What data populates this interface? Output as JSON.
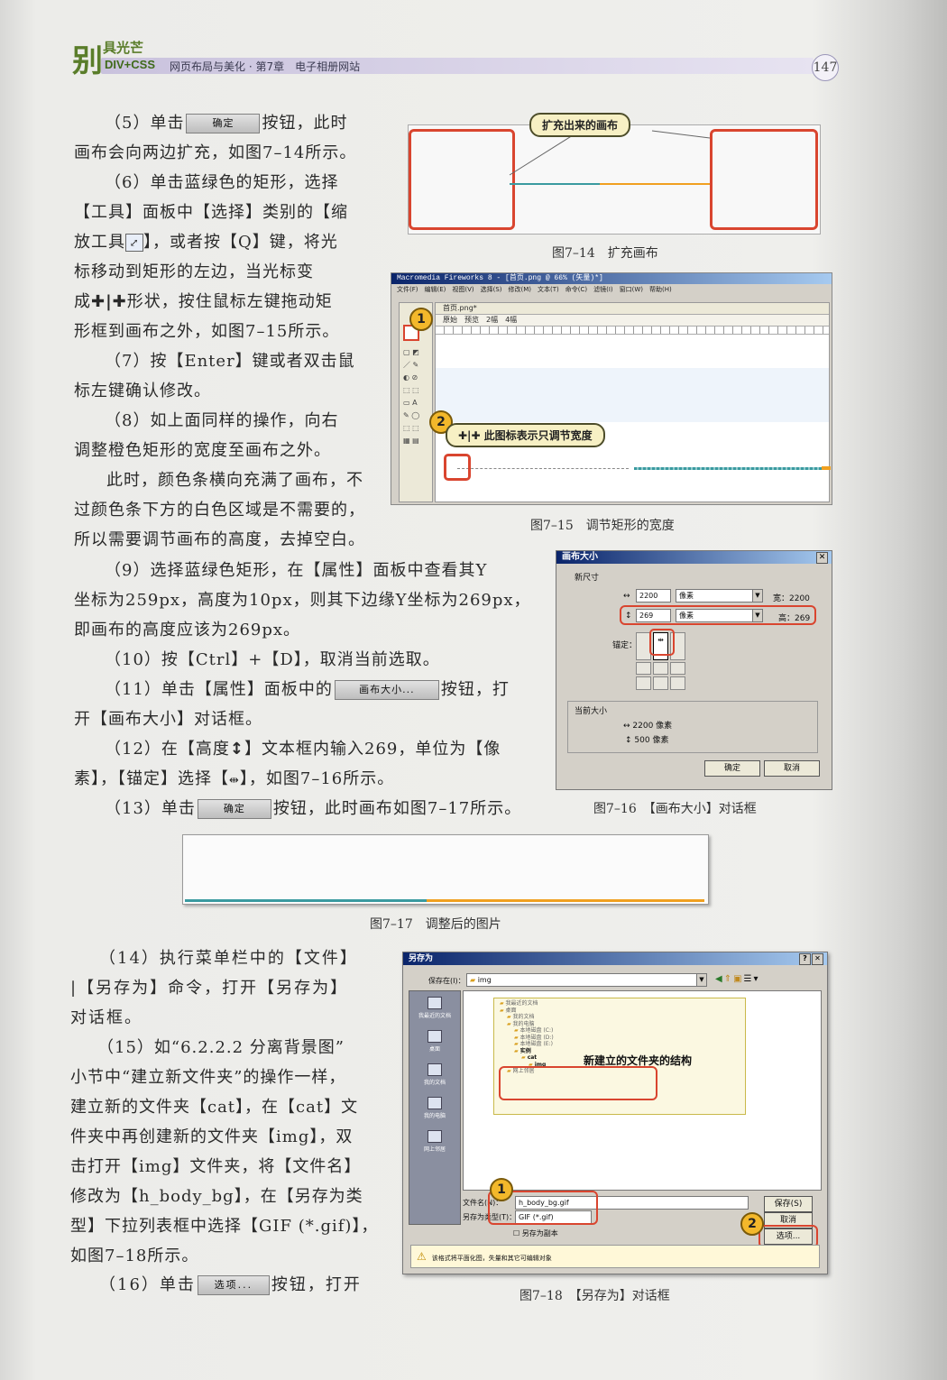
{
  "header": {
    "logo_char": "别",
    "logo_rest": "具光芒",
    "series": "DIV+CSS",
    "title": "网页布局与美化 · 第7章　电子相册网站",
    "page_number": "147"
  },
  "buttons": {
    "ok": "确定",
    "canvas_size": "画布大小...",
    "options": "选项..."
  },
  "body": {
    "s5a": "（5）单击",
    "s5b": "按钮，此时",
    "s5c": "画布会向两边扩充，如图7–14所示。",
    "s6a": "（6）单击蓝绿色的矩形，选择",
    "s6b": "【工具】面板中【选择】类别的【缩",
    "s6c": "放工具",
    "s6d": "】，或者按【Q】键，将光",
    "s6e": "标移动到矩形的左边，当光标变",
    "s6f": "成",
    "s6g": "形状，按住鼠标左键拖动矩",
    "s6h": "形框到画布之外，如图7–15所示。",
    "s7a": "（7）按【Enter】键或者双击鼠",
    "s7b": "标左键确认修改。",
    "s8a": "（8）如上面同样的操作，向右",
    "s8b": "调整橙色矩形的宽度至画布之外。",
    "n1": "此时，颜色条横向充满了画布，不",
    "n2": "过颜色条下方的白色区域是不需要的，",
    "n3": "所以需要调节画布的高度，去掉空白。",
    "s9a": "（9）选择蓝绿色矩形，在【属性】面板中查看其Y",
    "s9b": "坐标为259px，高度为10px，则其下边缘Y坐标为269px，",
    "s9c": "即画布的高度应该为269px。",
    "s10": "（10）按【Ctrl】+【D】，取消当前选取。",
    "s11a": "（11）单击【属性】面板中的",
    "s11b": "按钮，打",
    "s11c": "开【画布大小】对话框。",
    "s12a": "（12）在【高度",
    "s12b": "】文本框内输入269，单位为【像",
    "s12c": "素】，【锚定】选择【",
    "s12d": "】，如图7–16所示。",
    "s13a": "（13）单击",
    "s13b": "按钮，此时画布如图7–17所示。",
    "s14a": "（14）执行菜单栏中的【文件】",
    "s14b": "|【另存为】命令，打开【另存为】",
    "s14c": "对话框。",
    "s15a": "（15）如“6.2.2.2 分离背景图”",
    "s15b": "小节中“建立新文件夹”的操作一样，",
    "s15c": "建立新的文件夹【cat】，在【cat】文",
    "s15d": "件夹中再创建新的文件夹【img】，双",
    "s15e": "击打开【img】文件夹，将【文件名】",
    "s15f": "修改为【h_body_bg】，在【另存为类",
    "s15g": "型】下拉列表框中选择【GIF (*.gif)】，",
    "s15h": "如图7–18所示。",
    "s16a": "（16）单击",
    "s16b": "按钮，打开"
  },
  "fig14": {
    "callout": "扩充出来的画布",
    "caption": "图7–14　扩充画布"
  },
  "fig15": {
    "window_title": "Macromedia Fireworks 8 - [首页.png @ 66% (矢量)*]",
    "menu": "文件(F)　编辑(E)　视图(V)　选择(S)　修改(M)　文本(T)　命令(C)　滤镜(I)　窗口(W)　帮助(H)",
    "tab": "首页.png*",
    "view_tabs": "原始　预览　2幅　4幅",
    "marker1": "1",
    "marker2": "2",
    "callout": "此图标表示只调节宽度",
    "caption": "图7–15　调节矩形的宽度"
  },
  "fig16": {
    "title": "画布大小",
    "new_size": "新尺寸",
    "width_value": "2200",
    "height_value": "269",
    "unit": "像素",
    "width_label": "宽：2200",
    "height_label": "高：269",
    "anchor": "锚定：",
    "current_size": "当前大小",
    "cur_width": "2200 像素",
    "cur_height": "500 像素",
    "ok": "确定",
    "cancel": "取消",
    "caption": "图7–16　【画布大小】对话框"
  },
  "fig17": {
    "caption": "图7–17　调整后的图片"
  },
  "fig18": {
    "title": "另存为",
    "save_in_label": "保存在(I)：",
    "save_in_value": "img",
    "places": [
      "我最近的文档",
      "桌面",
      "我的文档",
      "我的电脑",
      "网上邻居"
    ],
    "tree": [
      "我最近的文档",
      "桌面",
      "我的文档",
      "我的电脑",
      "本地磁盘 (C:)",
      "本地磁盘 (D:)",
      "本地磁盘 (E:)",
      "实例",
      "cat",
      "img",
      "网上邻居"
    ],
    "callout": "新建立的文件夹的结构",
    "filename_label": "文件名(N)：",
    "filename_value": "h_body_bg.gif",
    "type_label": "另存为类型(T)：",
    "type_value": "GIF (*.gif)",
    "copy_label": "另存为副本",
    "save": "保存(S)",
    "cancel": "取消",
    "options": "选项...",
    "warning": "该格式将平面化图，失量和其它可编辑对象",
    "marker1": "1",
    "marker2": "2",
    "caption": "图7–18　【另存为】对话框"
  }
}
